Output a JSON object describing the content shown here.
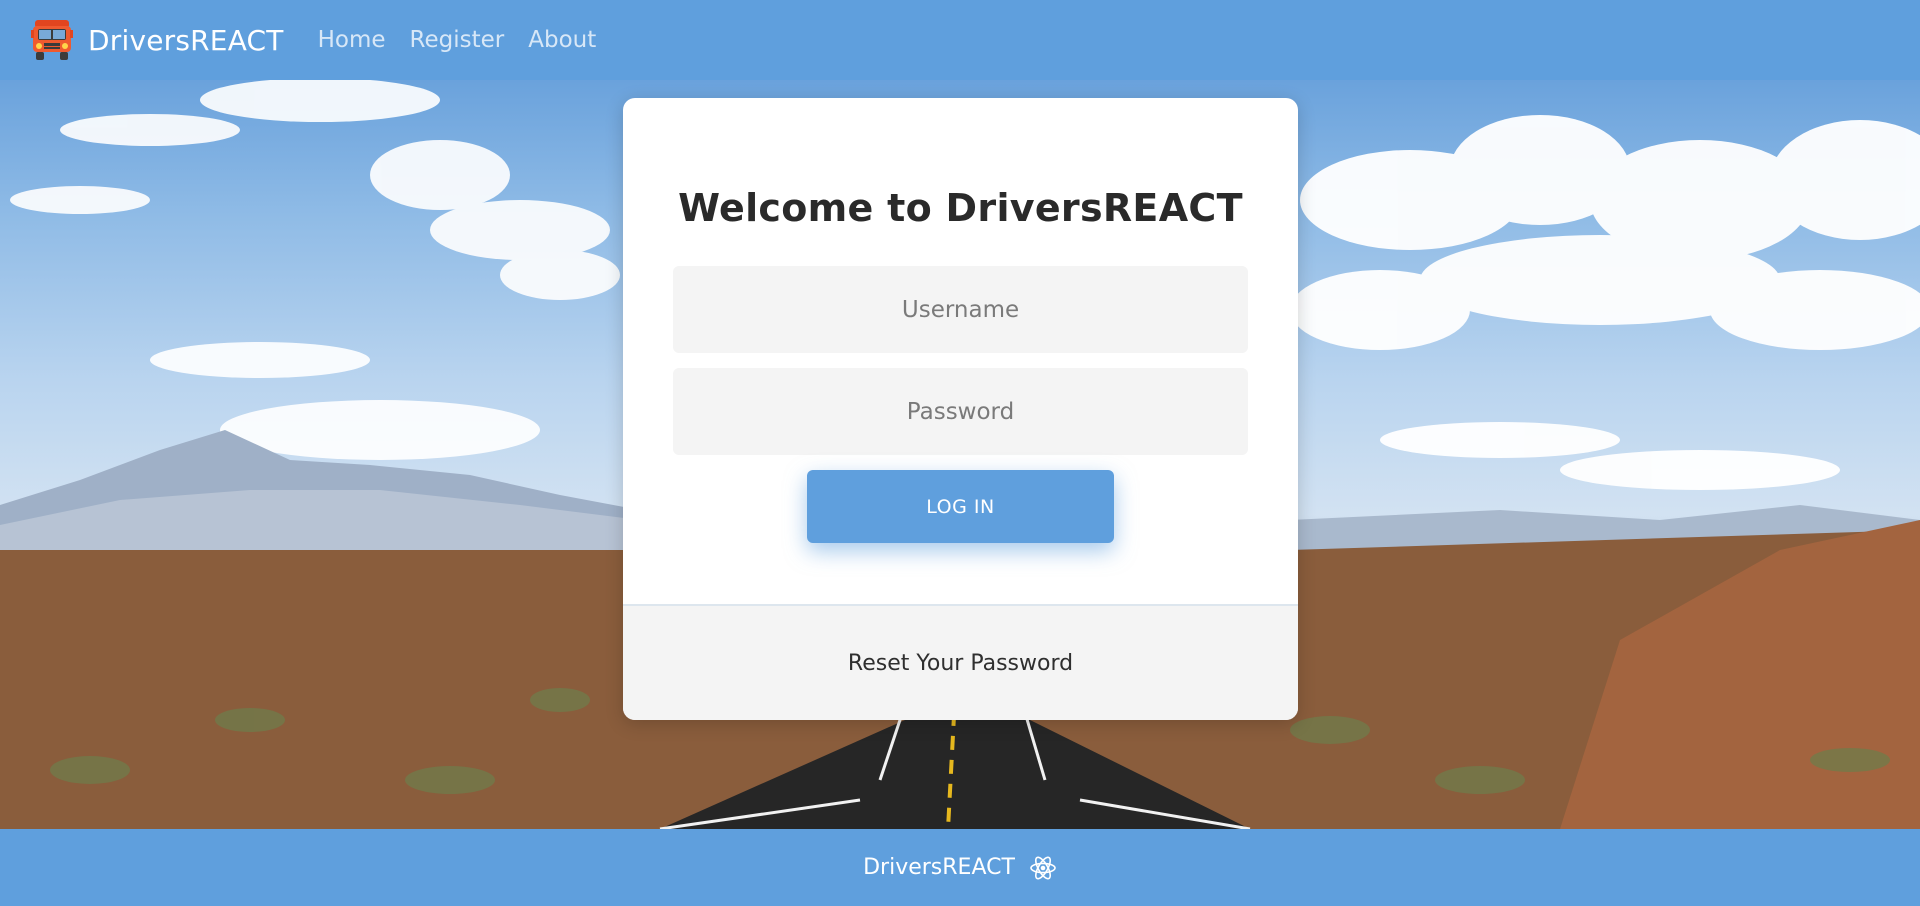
{
  "nav": {
    "brand": "DriversREACT",
    "brand_icon": "truck-icon",
    "links": [
      "Home",
      "Register",
      "About"
    ]
  },
  "login": {
    "title": "Welcome to DriversREACT",
    "username_placeholder": "Username",
    "password_placeholder": "Password",
    "button_label": "LOG IN",
    "reset_label": "Reset Your Password"
  },
  "footer": {
    "text": "DriversREACT",
    "icon": "react-icon"
  },
  "colors": {
    "primary": "#5f9fdd",
    "card": "#ffffff",
    "input_bg": "#f4f4f4"
  }
}
